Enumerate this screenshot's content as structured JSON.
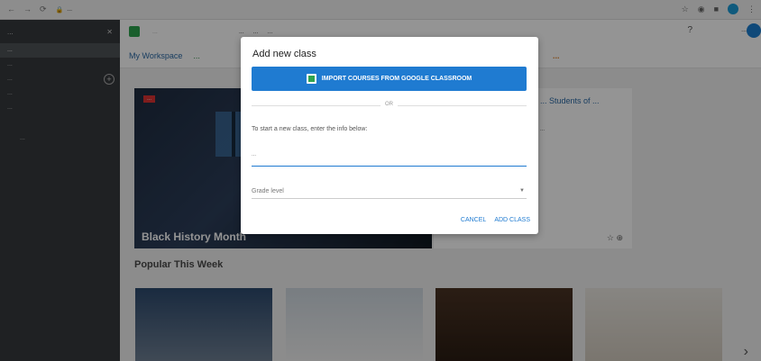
{
  "browser": {
    "nav_back": "←",
    "nav_forward": "→",
    "nav_reload": "⟳",
    "url": "..."
  },
  "sidebar": {
    "brand": "...",
    "items": [
      {
        "label": "..."
      },
      {
        "label": "..."
      },
      {
        "label": "..."
      },
      {
        "label": "..."
      },
      {
        "label": "..."
      }
    ],
    "signout": "..."
  },
  "topbar": {
    "search_placeholder": "...",
    "dropdowns": [
      "...",
      "...",
      "..."
    ],
    "help": "?",
    "user": "..."
  },
  "tabs": {
    "items": [
      {
        "label": "My Workspace"
      },
      {
        "label": "..."
      }
    ],
    "highlight": "..."
  },
  "content": {
    "hero_badge": "...",
    "hero_title": "Black History Month",
    "side_title": "... Students of ...",
    "side_text": "...",
    "popular_title": "Popular This Week"
  },
  "modal": {
    "title": "Add new class",
    "import_label": "IMPORT COURSES FROM GOOGLE CLASSROOM",
    "or_label": "OR",
    "instructions": "To start a new class, enter the info below:",
    "class_placeholder": "...",
    "grade_label": "Grade level",
    "cancel_label": "CANCEL",
    "add_label": "ADD CLASS"
  }
}
